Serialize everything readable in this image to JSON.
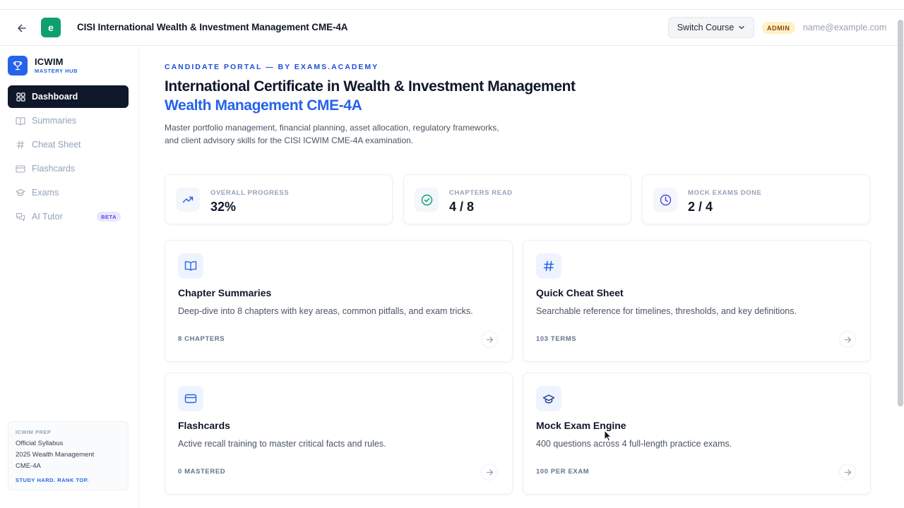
{
  "header": {
    "back_label": "Back",
    "logo_letter": "e",
    "course_title": "CISI International Wealth & Investment Management CME-4A",
    "switch_course_label": "Switch Course",
    "admin_badge": "ADMIN",
    "user_email": "name@example.com",
    "logo_color": "#0e9f6e"
  },
  "sidebar": {
    "brand_name": "ICWIM",
    "brand_sub": "MASTERY HUB",
    "items": [
      {
        "label": "Dashboard",
        "icon": "grid-icon",
        "active": true
      },
      {
        "label": "Summaries",
        "icon": "book-icon"
      },
      {
        "label": "Cheat Sheet",
        "icon": "hash-icon"
      },
      {
        "label": "Flashcards",
        "icon": "card-icon"
      },
      {
        "label": "Exams",
        "icon": "graduation-cap-icon"
      },
      {
        "label": "AI Tutor",
        "icon": "chat-icon",
        "badge": "BETA"
      }
    ],
    "promo": {
      "kicker": "ICWIM PREP",
      "line1": "Official Syllabus",
      "line2": "2025 Wealth Management",
      "line3": "CME-4A",
      "footer": "STUDY HARD. RANK TOP."
    }
  },
  "main": {
    "kicker": "CANDIDATE PORTAL — BY EXAMS.ACADEMY",
    "title_line1": "International Certificate in Wealth & Investment Management",
    "title_line2": "Wealth Management CME-4A",
    "description": "Master portfolio management, financial planning, asset allocation, regulatory frameworks, and client advisory skills for the CISI ICWIM CME-4A examination.",
    "stats": [
      {
        "label": "OVERALL PROGRESS",
        "value": "32%",
        "icon": "trending-up-icon"
      },
      {
        "label": "CHAPTERS READ",
        "value": "4 / 8",
        "icon": "check-circle-icon"
      },
      {
        "label": "MOCK EXAMS DONE",
        "value": "2 / 4",
        "icon": "clock-icon"
      }
    ],
    "cards": [
      {
        "title": "Chapter Summaries",
        "desc": "Deep-dive into 8 chapters with key areas, common pitfalls, and exam tricks.",
        "meta": "8 CHAPTERS",
        "icon": "book-open-icon"
      },
      {
        "title": "Quick Cheat Sheet",
        "desc": "Searchable reference for timelines, thresholds, and key definitions.",
        "meta": "103 TERMS",
        "icon": "hash-icon"
      },
      {
        "title": "Flashcards",
        "desc": "Active recall training to master critical facts and rules.",
        "meta": "0 MASTERED",
        "icon": "card-icon"
      },
      {
        "title": "Mock Exam Engine",
        "desc": "400 questions across 4 full-length practice exams.",
        "meta": "100 PER EXAM",
        "icon": "graduation-cap-icon"
      }
    ]
  },
  "colors": {
    "accent": "#2563eb",
    "nav_active_bg": "#0f172a",
    "stat_icon_green": "#0e9f6e",
    "stat_icon_indigo": "#4f46e5"
  }
}
